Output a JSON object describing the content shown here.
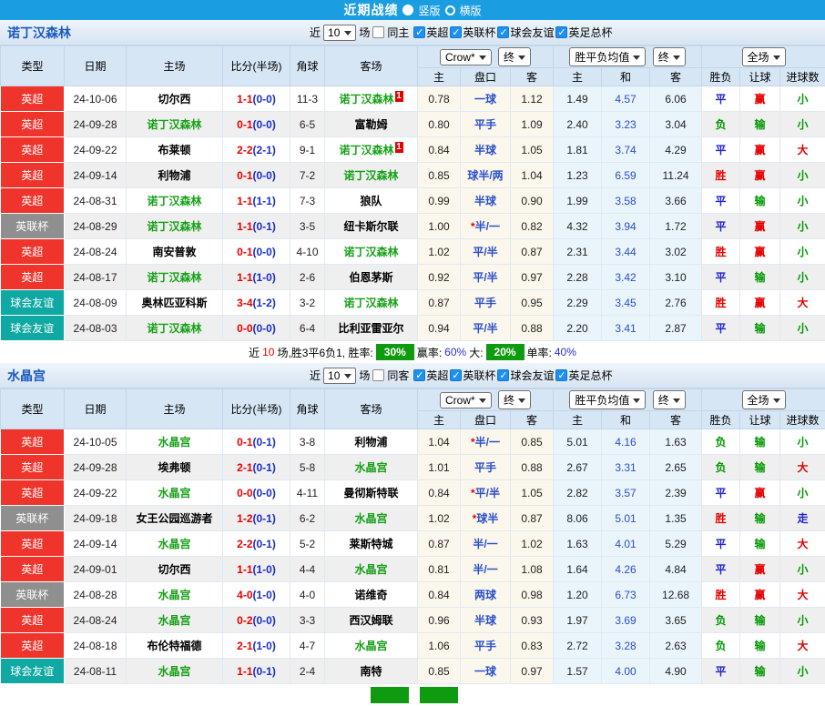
{
  "topbar": {
    "title": "近期战绩",
    "vertical": "竖版",
    "horizontal": "横版"
  },
  "filters": {
    "near": "近",
    "count": "10",
    "games": "场",
    "leagues": [
      "英超",
      "英联杯",
      "球会友谊",
      "英足总杯"
    ]
  },
  "header": {
    "type": "类型",
    "date": "日期",
    "home": "主场",
    "score": "比分(半场)",
    "corner": "角球",
    "away": "客场",
    "company": "Crow*",
    "final": "终",
    "avg": "胜平负均值",
    "fullmatch": "全场",
    "h": "主",
    "hcp": "盘口",
    "a": "客",
    "w": "主",
    "d": "和",
    "l": "客",
    "res": "胜负",
    "hc": "让球",
    "goals": "进球数"
  },
  "type_colors": {
    "英超": "#ef342c",
    "英联杯": "#8f8f8f",
    "球会友谊": "#10a8a2"
  },
  "result_colors": {
    "胜": "#e60000",
    "平": "#2222cc",
    "负": "#009900",
    "赢": "#e60000",
    "输": "#009900",
    "走": "#2222cc",
    "大": "#e60000",
    "小": "#009900"
  },
  "accent": {
    "topbar": "#1b9de2",
    "team_link": "#1a5bbf",
    "focus_team": "#15a015",
    "rate_badge": "#0f9b0f"
  },
  "sections": [
    {
      "team": "诺丁汉森林",
      "same_label": "同主",
      "rows": [
        {
          "type": "英超",
          "date": "24-10-06",
          "home": "切尔西",
          "home_focus": false,
          "score": "1-1",
          "half": "(0-0)",
          "corner": "11-3",
          "away": "诺丁汉森林",
          "away_focus": true,
          "away_badge": "1",
          "h_odds": "0.78",
          "handicap": "一球",
          "a_odds": "1.12",
          "avg_w": "1.49",
          "avg_d": "4.57",
          "avg_l": "6.06",
          "res": "平",
          "hc_res": "赢",
          "goal_res": "小"
        },
        {
          "type": "英超",
          "date": "24-09-28",
          "home": "诺丁汉森林",
          "home_focus": true,
          "score": "0-1",
          "half": "(0-0)",
          "corner": "6-5",
          "away": "富勒姆",
          "away_focus": false,
          "h_odds": "0.80",
          "handicap": "平手",
          "a_odds": "1.09",
          "avg_w": "2.40",
          "avg_d": "3.23",
          "avg_l": "3.04",
          "res": "负",
          "hc_res": "输",
          "goal_res": "小"
        },
        {
          "type": "英超",
          "date": "24-09-22",
          "home": "布莱顿",
          "home_focus": false,
          "score": "2-2",
          "half": "(2-1)",
          "corner": "9-1",
          "away": "诺丁汉森林",
          "away_focus": true,
          "away_badge": "1",
          "h_odds": "0.84",
          "handicap": "半球",
          "a_odds": "1.05",
          "avg_w": "1.81",
          "avg_d": "3.74",
          "avg_l": "4.29",
          "res": "平",
          "hc_res": "赢",
          "goal_res": "大"
        },
        {
          "type": "英超",
          "date": "24-09-14",
          "home": "利物浦",
          "home_focus": false,
          "score": "0-1",
          "half": "(0-0)",
          "corner": "7-2",
          "away": "诺丁汉森林",
          "away_focus": true,
          "h_odds": "0.85",
          "handicap": "球半/两",
          "a_odds": "1.04",
          "avg_w": "1.23",
          "avg_d": "6.59",
          "avg_l": "11.24",
          "res": "胜",
          "hc_res": "赢",
          "goal_res": "小"
        },
        {
          "type": "英超",
          "date": "24-08-31",
          "home": "诺丁汉森林",
          "home_focus": true,
          "score": "1-1",
          "half": "(1-1)",
          "corner": "7-3",
          "away": "狼队",
          "away_focus": false,
          "h_odds": "0.99",
          "handicap": "半球",
          "a_odds": "0.90",
          "avg_w": "1.99",
          "avg_d": "3.58",
          "avg_l": "3.66",
          "res": "平",
          "hc_res": "输",
          "goal_res": "小"
        },
        {
          "type": "英联杯",
          "date": "24-08-29",
          "home": "诺丁汉森林",
          "home_focus": true,
          "score": "1-1",
          "half": "(0-1)",
          "corner": "3-5",
          "away": "纽卡斯尔联",
          "away_focus": false,
          "h_odds": "1.00",
          "handicap": "*半/一",
          "a_odds": "0.82",
          "avg_w": "4.32",
          "avg_d": "3.94",
          "avg_l": "1.72",
          "res": "平",
          "hc_res": "赢",
          "goal_res": "小"
        },
        {
          "type": "英超",
          "date": "24-08-24",
          "home": "南安普敦",
          "home_focus": false,
          "score": "0-1",
          "half": "(0-0)",
          "corner": "4-10",
          "away": "诺丁汉森林",
          "away_focus": true,
          "h_odds": "1.02",
          "handicap": "平/半",
          "a_odds": "0.87",
          "avg_w": "2.31",
          "avg_d": "3.44",
          "avg_l": "3.02",
          "res": "胜",
          "hc_res": "赢",
          "goal_res": "小"
        },
        {
          "type": "英超",
          "date": "24-08-17",
          "home": "诺丁汉森林",
          "home_focus": true,
          "score": "1-1",
          "half": "(1-0)",
          "corner": "2-6",
          "away": "伯恩茅斯",
          "away_focus": false,
          "h_odds": "0.92",
          "handicap": "平/半",
          "a_odds": "0.97",
          "avg_w": "2.28",
          "avg_d": "3.42",
          "avg_l": "3.10",
          "res": "平",
          "hc_res": "输",
          "goal_res": "小"
        },
        {
          "type": "球会友谊",
          "date": "24-08-09",
          "home": "奥林匹亚科斯",
          "home_focus": false,
          "score": "3-4",
          "half": "(1-2)",
          "corner": "3-2",
          "away": "诺丁汉森林",
          "away_focus": true,
          "h_odds": "0.87",
          "handicap": "平手",
          "a_odds": "0.95",
          "avg_w": "2.29",
          "avg_d": "3.45",
          "avg_l": "2.76",
          "res": "胜",
          "hc_res": "赢",
          "goal_res": "大"
        },
        {
          "type": "球会友谊",
          "date": "24-08-03",
          "home": "诺丁汉森林",
          "home_focus": true,
          "score": "0-0",
          "half": "(0-0)",
          "corner": "6-4",
          "away": "比利亚雷亚尔",
          "away_focus": false,
          "h_odds": "0.94",
          "handicap": "平/半",
          "a_odds": "0.88",
          "avg_w": "2.20",
          "avg_d": "3.41",
          "avg_l": "2.87",
          "res": "平",
          "hc_res": "输",
          "goal_res": "小"
        }
      ],
      "summary": {
        "near": "近",
        "count": "10",
        "stats": "场,胜3平6负1, 胜率:",
        "win_badge": "30%",
        "hc_label": "赢率:",
        "hc_rate": "60%",
        "big_label": "大:",
        "big_badge": "20%",
        "single_label": "单率:",
        "single_rate": "40%"
      }
    },
    {
      "team": "水晶宫",
      "same_label": "同客",
      "rows": [
        {
          "type": "英超",
          "date": "24-10-05",
          "home": "水晶宫",
          "home_focus": true,
          "score": "0-1",
          "half": "(0-1)",
          "corner": "3-8",
          "away": "利物浦",
          "away_focus": false,
          "h_odds": "1.04",
          "handicap": "*半/一",
          "a_odds": "0.85",
          "avg_w": "5.01",
          "avg_d": "4.16",
          "avg_l": "1.63",
          "res": "负",
          "hc_res": "输",
          "goal_res": "小"
        },
        {
          "type": "英超",
          "date": "24-09-28",
          "home": "埃弗顿",
          "home_focus": false,
          "score": "2-1",
          "half": "(0-1)",
          "corner": "5-8",
          "away": "水晶宫",
          "away_focus": true,
          "h_odds": "1.01",
          "handicap": "平手",
          "a_odds": "0.88",
          "avg_w": "2.67",
          "avg_d": "3.31",
          "avg_l": "2.65",
          "res": "负",
          "hc_res": "输",
          "goal_res": "大"
        },
        {
          "type": "英超",
          "date": "24-09-22",
          "home": "水晶宫",
          "home_focus": true,
          "score": "0-0",
          "half": "(0-0)",
          "corner": "4-11",
          "away": "曼彻斯特联",
          "away_focus": false,
          "h_odds": "0.84",
          "handicap": "*平/半",
          "a_odds": "1.05",
          "avg_w": "2.82",
          "avg_d": "3.57",
          "avg_l": "2.39",
          "res": "平",
          "hc_res": "赢",
          "goal_res": "小"
        },
        {
          "type": "英联杯",
          "date": "24-09-18",
          "home": "女王公园巡游者",
          "home_focus": false,
          "score": "1-2",
          "half": "(0-1)",
          "corner": "6-2",
          "away": "水晶宫",
          "away_focus": true,
          "h_odds": "1.02",
          "handicap": "*球半",
          "a_odds": "0.87",
          "avg_w": "8.06",
          "avg_d": "5.01",
          "avg_l": "1.35",
          "res": "胜",
          "hc_res": "输",
          "goal_res": "走"
        },
        {
          "type": "英超",
          "date": "24-09-14",
          "home": "水晶宫",
          "home_focus": true,
          "score": "2-2",
          "half": "(0-1)",
          "corner": "5-2",
          "away": "莱斯特城",
          "away_focus": false,
          "h_odds": "0.87",
          "handicap": "半/一",
          "a_odds": "1.02",
          "avg_w": "1.63",
          "avg_d": "4.01",
          "avg_l": "5.29",
          "res": "平",
          "hc_res": "输",
          "goal_res": "大"
        },
        {
          "type": "英超",
          "date": "24-09-01",
          "home": "切尔西",
          "home_focus": false,
          "score": "1-1",
          "half": "(1-0)",
          "corner": "4-4",
          "away": "水晶宫",
          "away_focus": true,
          "h_odds": "0.81",
          "handicap": "半/一",
          "a_odds": "1.08",
          "avg_w": "1.64",
          "avg_d": "4.26",
          "avg_l": "4.84",
          "res": "平",
          "hc_res": "赢",
          "goal_res": "小"
        },
        {
          "type": "英联杯",
          "date": "24-08-28",
          "home": "水晶宫",
          "home_focus": true,
          "score": "4-0",
          "half": "(1-0)",
          "corner": "4-0",
          "away": "诺维奇",
          "away_focus": false,
          "h_odds": "0.84",
          "handicap": "两球",
          "a_odds": "0.98",
          "avg_w": "1.20",
          "avg_d": "6.73",
          "avg_l": "12.68",
          "res": "胜",
          "hc_res": "赢",
          "goal_res": "大"
        },
        {
          "type": "英超",
          "date": "24-08-24",
          "home": "水晶宫",
          "home_focus": true,
          "score": "0-2",
          "half": "(0-0)",
          "corner": "3-3",
          "away": "西汉姆联",
          "away_focus": false,
          "h_odds": "0.96",
          "handicap": "半球",
          "a_odds": "0.93",
          "avg_w": "1.97",
          "avg_d": "3.69",
          "avg_l": "3.65",
          "res": "负",
          "hc_res": "输",
          "goal_res": "小"
        },
        {
          "type": "英超",
          "date": "24-08-18",
          "home": "布伦特福德",
          "home_focus": false,
          "score": "2-1",
          "half": "(1-0)",
          "corner": "4-7",
          "away": "水晶宫",
          "away_focus": true,
          "h_odds": "1.06",
          "handicap": "平手",
          "a_odds": "0.83",
          "avg_w": "2.72",
          "avg_d": "3.28",
          "avg_l": "2.63",
          "res": "负",
          "hc_res": "输",
          "goal_res": "大"
        },
        {
          "type": "球会友谊",
          "date": "24-08-11",
          "home": "水晶宫",
          "home_focus": true,
          "score": "1-1",
          "half": "(0-1)",
          "corner": "2-4",
          "away": "南特",
          "away_focus": false,
          "h_odds": "0.85",
          "handicap": "一球",
          "a_odds": "0.97",
          "avg_w": "1.57",
          "avg_d": "4.00",
          "avg_l": "4.90",
          "res": "平",
          "hc_res": "输",
          "goal_res": "小"
        }
      ],
      "summary": {
        "near": "",
        "count": "",
        "stats": "",
        "win_badge": "",
        "hc_label": "",
        "hc_rate": "",
        "big_label": "",
        "big_badge": "",
        "single_label": "",
        "single_rate": ""
      }
    }
  ]
}
